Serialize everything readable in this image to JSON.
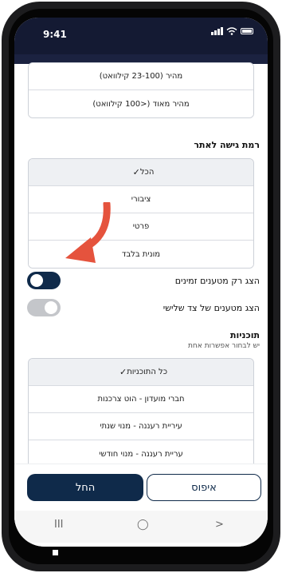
{
  "status": {
    "time": "9:41"
  },
  "speed_options": [
    "מהיר (23-100 קילוואט)",
    "מהיר מאוד (<100 קילוואט)"
  ],
  "access": {
    "title": "רמת גישה לאתר",
    "options": [
      {
        "label": "הכל",
        "selected": true
      },
      {
        "label": "ציבורי",
        "selected": false
      },
      {
        "label": "פרטי",
        "selected": false
      },
      {
        "label": "מונית בלבד",
        "selected": false
      }
    ]
  },
  "toggles": [
    {
      "label": "הצג רק מטענים זמינים",
      "on": true
    },
    {
      "label": "הצג מטענים של צד שלישי",
      "on": false
    }
  ],
  "plans": {
    "title": "תוכניות",
    "subtitle": "יש לבחור אפשרות אחת",
    "options": [
      {
        "label": "כל התוכניות",
        "selected": true
      },
      {
        "label": "חברי מועדון - הוט צרכנות",
        "selected": false
      },
      {
        "label": "עיריית רעננה - מנוי שנתי",
        "selected": false
      },
      {
        "label": "עריית רעננה - מנוי חודשי",
        "selected": false
      }
    ]
  },
  "footer": {
    "reset_label": "איפוס",
    "start_label": "החל"
  },
  "nav": {
    "recents": "III",
    "home": "◯",
    "back": ">"
  },
  "colors": {
    "primary": "#0f2a4a",
    "arrow": "#e5533d"
  }
}
